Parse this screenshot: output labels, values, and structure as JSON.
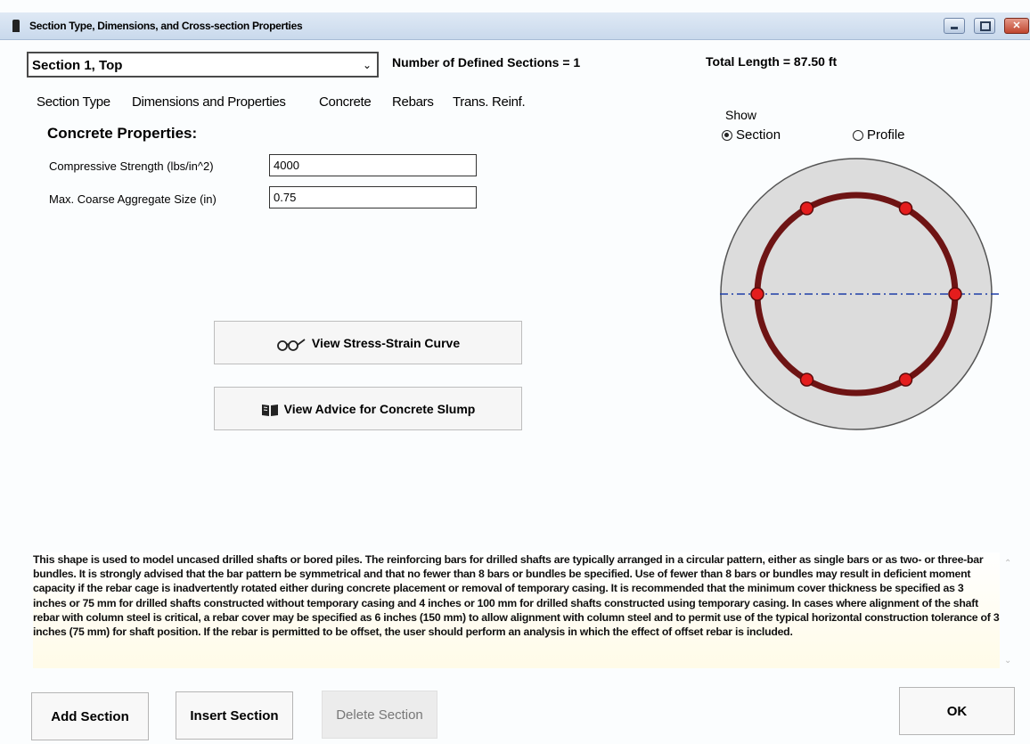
{
  "window": {
    "title": "Section Type, Dimensions, and Cross-section Properties",
    "controls": {
      "minimize_icon": "minimize-icon",
      "maximize_icon": "maximize-icon",
      "close_label": "✕"
    }
  },
  "header": {
    "section_select": {
      "value": "Section 1, Top",
      "chevron": "⌄"
    },
    "defined_sections": "Number of Defined Sections = 1",
    "total_length": "Total Length = 87.50 ft"
  },
  "tabs": [
    {
      "label": "Section Type"
    },
    {
      "label": "Dimensions and Properties"
    },
    {
      "label": "Concrete",
      "active": true
    },
    {
      "label": "Rebars"
    },
    {
      "label": "Trans. Reinf."
    }
  ],
  "concrete": {
    "heading": "Concrete Properties:",
    "fields": [
      {
        "label": "Compressive Strength (lbs/in^2)",
        "value": "4000"
      },
      {
        "label": "Max. Coarse Aggregate Size (in)",
        "value": "0.75"
      }
    ]
  },
  "buttons": {
    "stress_strain": {
      "label": "View Stress-Strain Curve",
      "icon": "glasses-icon"
    },
    "slump_advice": {
      "label": "View Advice for Concrete Slump",
      "icon": "book-icon"
    }
  },
  "view": {
    "show_label": "Show",
    "options": [
      {
        "label": "Section",
        "selected": true
      },
      {
        "label": "Profile",
        "selected": false
      }
    ]
  },
  "section_drawing": {
    "rebar_count": 6,
    "colors": {
      "concrete": "#dcdcdc",
      "cage": "#6e1414",
      "rebar": "#e41d1d",
      "axis": "#1f3fa8"
    }
  },
  "description": "This shape is used to model uncased drilled shafts or bored piles. The reinforcing bars for drilled shafts are typically arranged in a circular pattern, either as single bars or as two- or three-bar bundles. It is strongly advised that the bar pattern be symmetrical and that no fewer than 8 bars or bundles be specified. Use of fewer than 8 bars or bundles may result in deficient moment capacity if the rebar cage is inadvertently rotated either during concrete placement or removal of temporary casing. It is recommended that the minimum cover thickness be specified as 3 inches or 75 mm for drilled shafts constructed without temporary casing and 4 inches or 100 mm for drilled shafts constructed using temporary casing. In cases where alignment of the shaft rebar with column steel is critical, a rebar cover may be specified as 6 inches (150 mm) to allow alignment with column steel and to permit use of the typical horizontal construction tolerance of 3 inches (75 mm) for shaft position. If the rebar is permitted to be offset, the user should perform an analysis in which the effect of offset rebar is included.",
  "footer": {
    "add_section": "Add Section",
    "insert_section": "Insert Section",
    "delete_section": "Delete Section",
    "ok": "OK"
  }
}
